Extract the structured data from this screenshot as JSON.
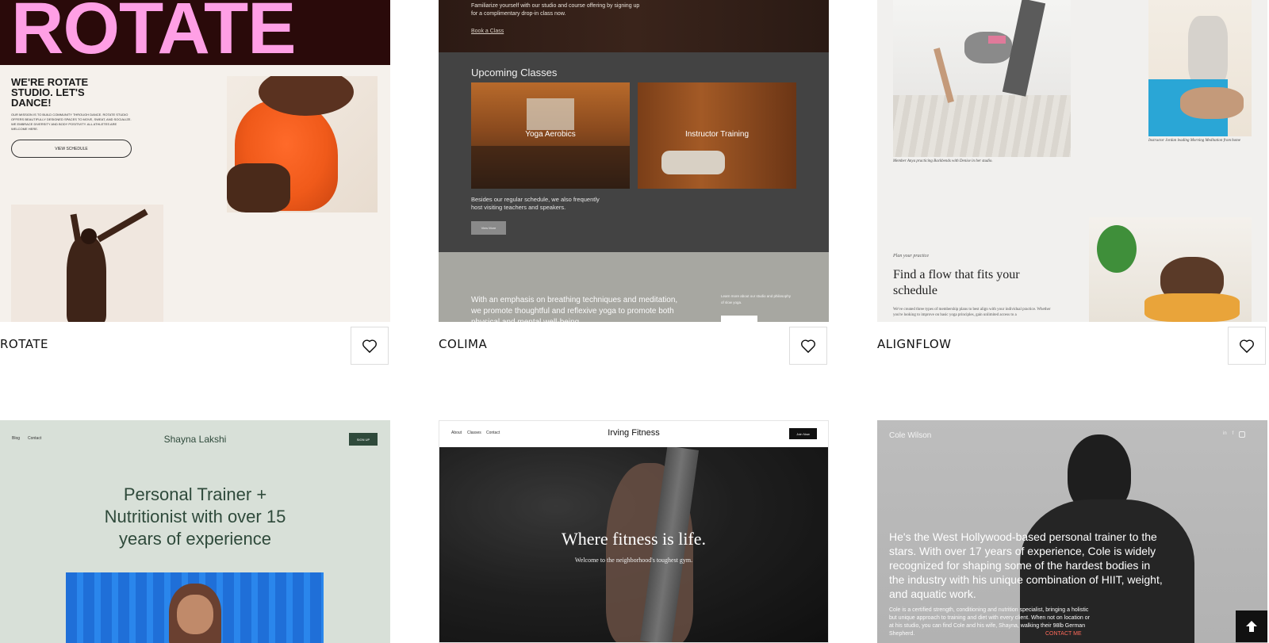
{
  "cards": [
    {
      "name": "ROTATE",
      "preview": {
        "logo": "ROTATE",
        "headline": "WE'RE ROTATE STUDIO. LET'S DANCE!",
        "body": "OUR MISSION IS TO BUILD COMMUNITY THROUGH DANCE. ROTATE STUDIO OFFERS BEAUTIFULLY DESIGNED SPACES TO MOVE, SWEAT, AND SOCIALIZE. WE EMBRACE DIVERSITY AND BODY POSITIVITY. ALL ATHLETES ARE WELCOME HERE.",
        "cta": "VIEW SCHEDULE"
      }
    },
    {
      "name": "COLIMA",
      "preview": {
        "intro": "Familiarize yourself with our studio and course offering by signing up for a complimentary drop-in class now.",
        "intro_link": "Book a Class",
        "section_title": "Upcoming Classes",
        "class_1": "Yoga Aerobics",
        "class_2": "Instructor Training",
        "note": "Besides our regular schedule, we also frequently host visiting teachers and speakers.",
        "note_btn": "View More",
        "bottom_text": "With an emphasis on breathing techniques and meditation, we promote thoughtful and reflexive yoga to promote both physical and mental well-being.",
        "side_text": "Learn more about our studio and philosophy of slow yoga."
      }
    },
    {
      "name": "ALIGNFLOW",
      "preview": {
        "caption_1": "Member Anya practicing Backbends with Denise in her studio.",
        "caption_2": "Instructor Jordan leading Morning Meditation from home",
        "eyebrow": "Plan your practice",
        "heading": "Find a flow that fits your schedule",
        "body": "We've created three types of membership plans to best align with your individual practice. Whether you're looking to improve on basic yoga principles, gain unlimited access to a"
      }
    },
    {
      "name": "",
      "preview": {
        "nav_1": "Blog",
        "nav_2": "Contact",
        "brand": "Shayna Lakshi",
        "signup": "SIGN UP",
        "headline": "Personal Trainer + Nutritionist with over 15 years of experience"
      }
    },
    {
      "name": "",
      "preview": {
        "nav_1": "About",
        "nav_2": "Classes",
        "nav_3": "Contact",
        "brand": "Irving Fitness",
        "join": "Join Now",
        "headline": "Where fitness is life.",
        "sub": "Welcome to the neighborhood's toughest gym."
      }
    },
    {
      "name": "",
      "preview": {
        "brand": "Cole Wilson",
        "headline": "He's the West Hollywood-based personal trainer to the stars. With over 17 years of experience, Cole is widely recognized for shaping some of the hardest bodies in the industry with his unique combination of HIIT, weight, and aquatic work.",
        "body": "Cole is a certified strength, conditioning and nutrition specialist, bringing a holistic but unique approach to training and diet with every client. When not on location or at his studio, you can find Cole and his wife, Shayna, walking their 98lb German Shepherd.",
        "contact": "CONTACT ME"
      }
    }
  ],
  "icons": {
    "favorite": "heart-icon",
    "scroll_top": "arrow-up-icon"
  },
  "colors": {
    "rotate_pink": "#ff9fe5",
    "colima_dark": "#434343",
    "shayna_bg": "#d8e0d8",
    "shayna_green": "#2f4a3b"
  }
}
